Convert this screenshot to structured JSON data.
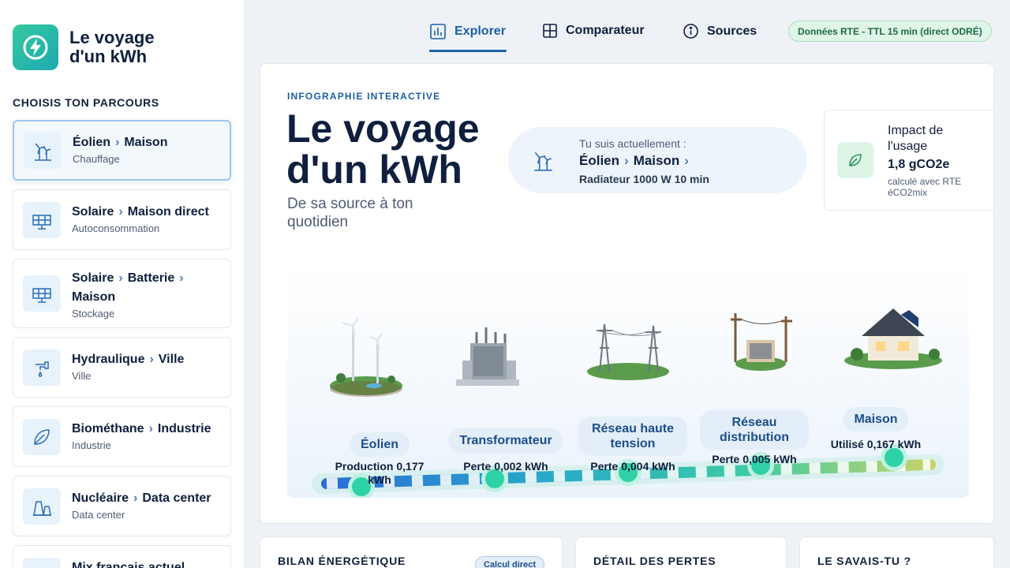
{
  "brand": {
    "title": "Le voyage d'un kWh"
  },
  "sidebar": {
    "section_label": "CHOISIS TON PARCOURS",
    "routes": [
      {
        "from": "Éolien",
        "to": "Maison",
        "via": "",
        "sub": "Chauffage",
        "icon": "wind-turbine-icon"
      },
      {
        "from": "Solaire",
        "to": "Maison direct",
        "via": "",
        "sub": "Autoconsommation",
        "icon": "solar-panel-icon"
      },
      {
        "from": "Solaire",
        "via": "Batterie",
        "to": "Maison",
        "sub": "Stockage",
        "icon": "solar-panel-icon"
      },
      {
        "from": "Hydraulique",
        "to": "Ville",
        "via": "",
        "sub": "Ville",
        "icon": "water-tap-icon"
      },
      {
        "from": "Biométhane",
        "to": "Industrie",
        "via": "",
        "sub": "Industrie",
        "icon": "leaf-icon"
      },
      {
        "from": "Nucléaire",
        "to": "Data center",
        "via": "",
        "sub": "Data center",
        "icon": "power-plant-icon"
      },
      {
        "from": "Mix français actuel",
        "to": "",
        "via": "",
        "sub": "",
        "icon": "mix-icon"
      }
    ]
  },
  "nav": {
    "explorer": "Explorer",
    "comparateur": "Comparateur",
    "sources": "Sources",
    "badge": "Données RTE - TTL 15 min (direct ODRÉ)"
  },
  "hero": {
    "kicker": "INFOGRAPHIE INTERACTIVE",
    "title": "Le voyage d'un kWh",
    "subtitle": "De sa source à ton quotidien"
  },
  "current": {
    "label": "Tu suis actuellement :",
    "from": "Éolien",
    "to": "Maison",
    "detail": "Radiateur 1000 W 10 min"
  },
  "impact": {
    "title": "Impact de l'usage",
    "value": "1,8 gCO2e",
    "note": "calculé avec RTE éCO2mix"
  },
  "journey": {
    "stages": [
      {
        "label": "Éolien",
        "metric": "Production 0,177 kWh"
      },
      {
        "label": "Transformateur",
        "metric": "Perte 0,002 kWh"
      },
      {
        "label": "Réseau haute tension",
        "metric": "Perte 0,004 kWh"
      },
      {
        "label": "Réseau distribution",
        "metric": "Perte 0,005 kWh"
      },
      {
        "label": "Maison",
        "metric": "Utilisé 0,167 kWh"
      }
    ]
  },
  "bottom": {
    "bilan": "BILAN ÉNERGÉTIQUE",
    "calc_badge": "Calcul direct",
    "pertes": "DÉTAIL DES PERTES",
    "savais": "LE SAVAIS-TU ?"
  },
  "colors": {
    "accent": "#1d5fa8",
    "brand": "#2bbfa3",
    "success": "#1d6b43"
  }
}
